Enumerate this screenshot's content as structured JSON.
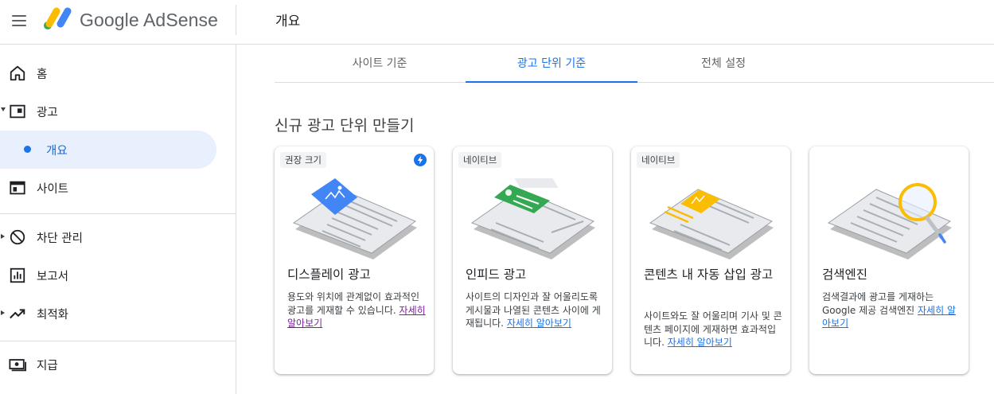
{
  "header": {
    "brand": "Google AdSense",
    "page_title": "개요"
  },
  "sidebar": {
    "items": [
      {
        "label": "홈",
        "icon": "home-icon"
      },
      {
        "label": "광고",
        "icon": "ads-icon"
      },
      {
        "label": "개요",
        "icon": "dot-icon",
        "active": true
      },
      {
        "label": "사이트",
        "icon": "sites-icon"
      },
      {
        "label": "차단 관리",
        "icon": "block-icon"
      },
      {
        "label": "보고서",
        "icon": "reports-icon"
      },
      {
        "label": "최적화",
        "icon": "optimization-icon"
      },
      {
        "label": "지급",
        "icon": "payments-icon"
      }
    ]
  },
  "tabs": [
    {
      "label": "사이트 기준"
    },
    {
      "label": "광고 단위 기준",
      "active": true
    },
    {
      "label": "전체 설정"
    }
  ],
  "section_title": "신규 광고 단위 만들기",
  "cards": [
    {
      "chip": "권장 크기",
      "title": "디스플레이 광고",
      "desc": "용도와 위치에 관계없이 효과적인 광고를 게재할 수 있습니다.",
      "link": "자세히 알아보기"
    },
    {
      "chip": "네이티브",
      "title": "인피드 광고",
      "desc": "사이트의 디자인과 잘 어울리도록 게시물과 나열된 콘텐츠 사이에 게재됩니다.",
      "link": "자세히 알아보기"
    },
    {
      "chip": "네이티브",
      "title": "콘텐츠 내 자동 삽입 광고",
      "desc": "사이트와도 잘 어울리며 기사 및 콘텐츠 페이지에 게재하면 효과적입니다.",
      "link": "자세히 알아보기"
    },
    {
      "chip": "",
      "title": "검색엔진",
      "desc": "검색결과에 광고를 게재하는 Google 제공 검색엔진",
      "link": "자세히 알아보기"
    }
  ],
  "colors": {
    "accent": "#1a73e8",
    "active_bg": "#e8f0fe",
    "display_ad": "#4285f4",
    "infeed_ad": "#34a853",
    "incontent_ad": "#fbbc04",
    "visited_link": "#7b1fa2"
  }
}
